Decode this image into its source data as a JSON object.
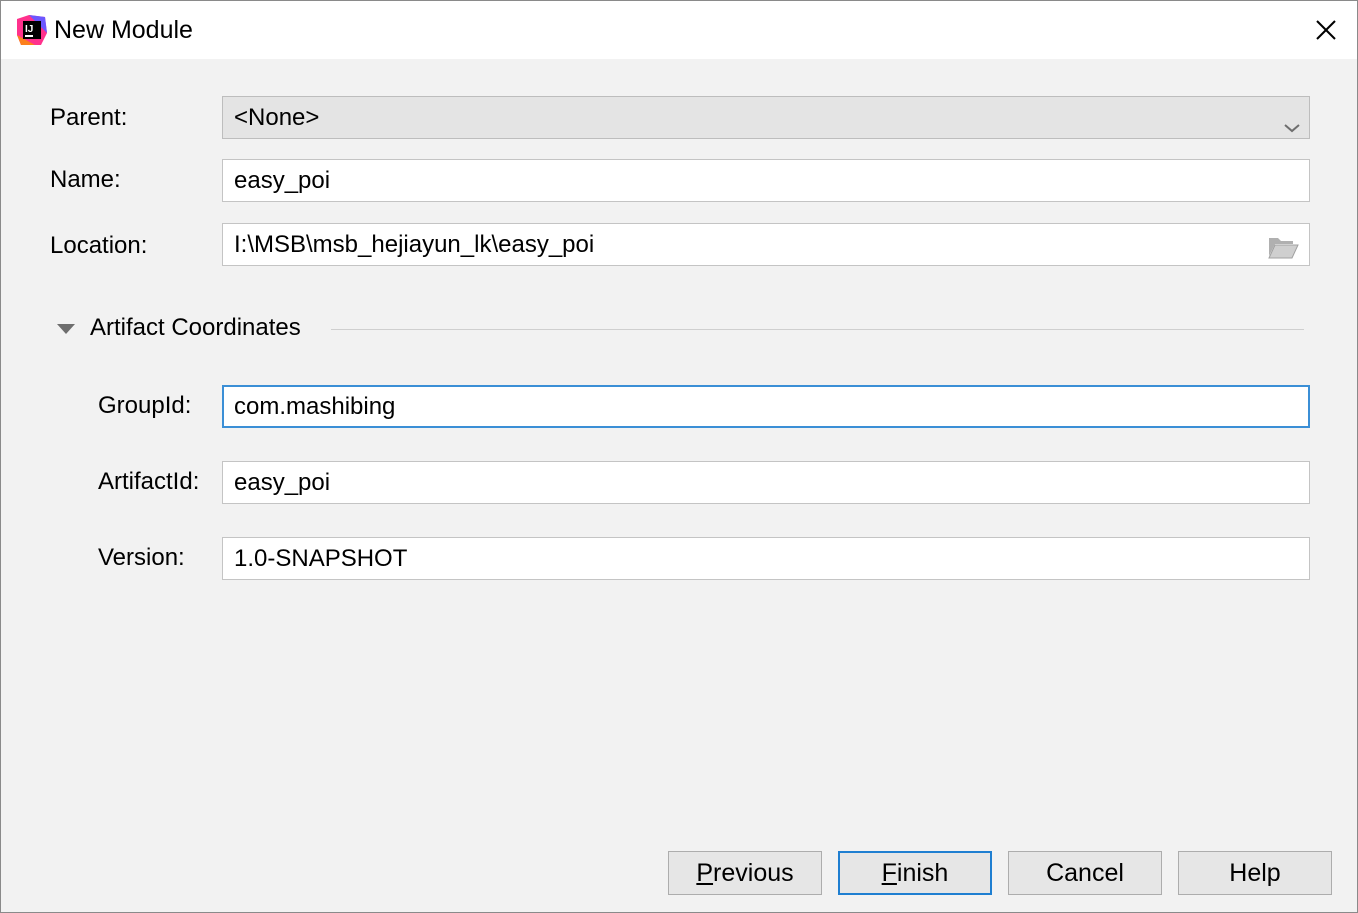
{
  "window": {
    "title": "New Module",
    "app_icon": "intellij-idea-icon",
    "close_icon": "close-icon"
  },
  "form": {
    "parent": {
      "label": "Parent:",
      "value": "<None>"
    },
    "name": {
      "label": "Name:",
      "value": "easy_poi"
    },
    "location": {
      "label": "Location:",
      "value": "I:\\MSB\\msb_hejiayun_lk\\easy_poi"
    }
  },
  "artifact": {
    "section_title": "Artifact Coordinates",
    "expanded": true,
    "group_id": {
      "label": "GroupId:",
      "value": "com.mashibing"
    },
    "artifact_id": {
      "label": "ArtifactId:",
      "value": "easy_poi"
    },
    "version": {
      "label": "Version:",
      "value": "1.0-SNAPSHOT"
    }
  },
  "buttons": {
    "previous": {
      "mnemonic": "P",
      "rest": "revious"
    },
    "finish": {
      "mnemonic": "F",
      "rest": "inish"
    },
    "cancel": "Cancel",
    "help": "Help"
  },
  "colors": {
    "focus_border": "#3b8fd6",
    "default_button_border": "#1f7fd1",
    "dialog_background": "#f2f2f2"
  }
}
